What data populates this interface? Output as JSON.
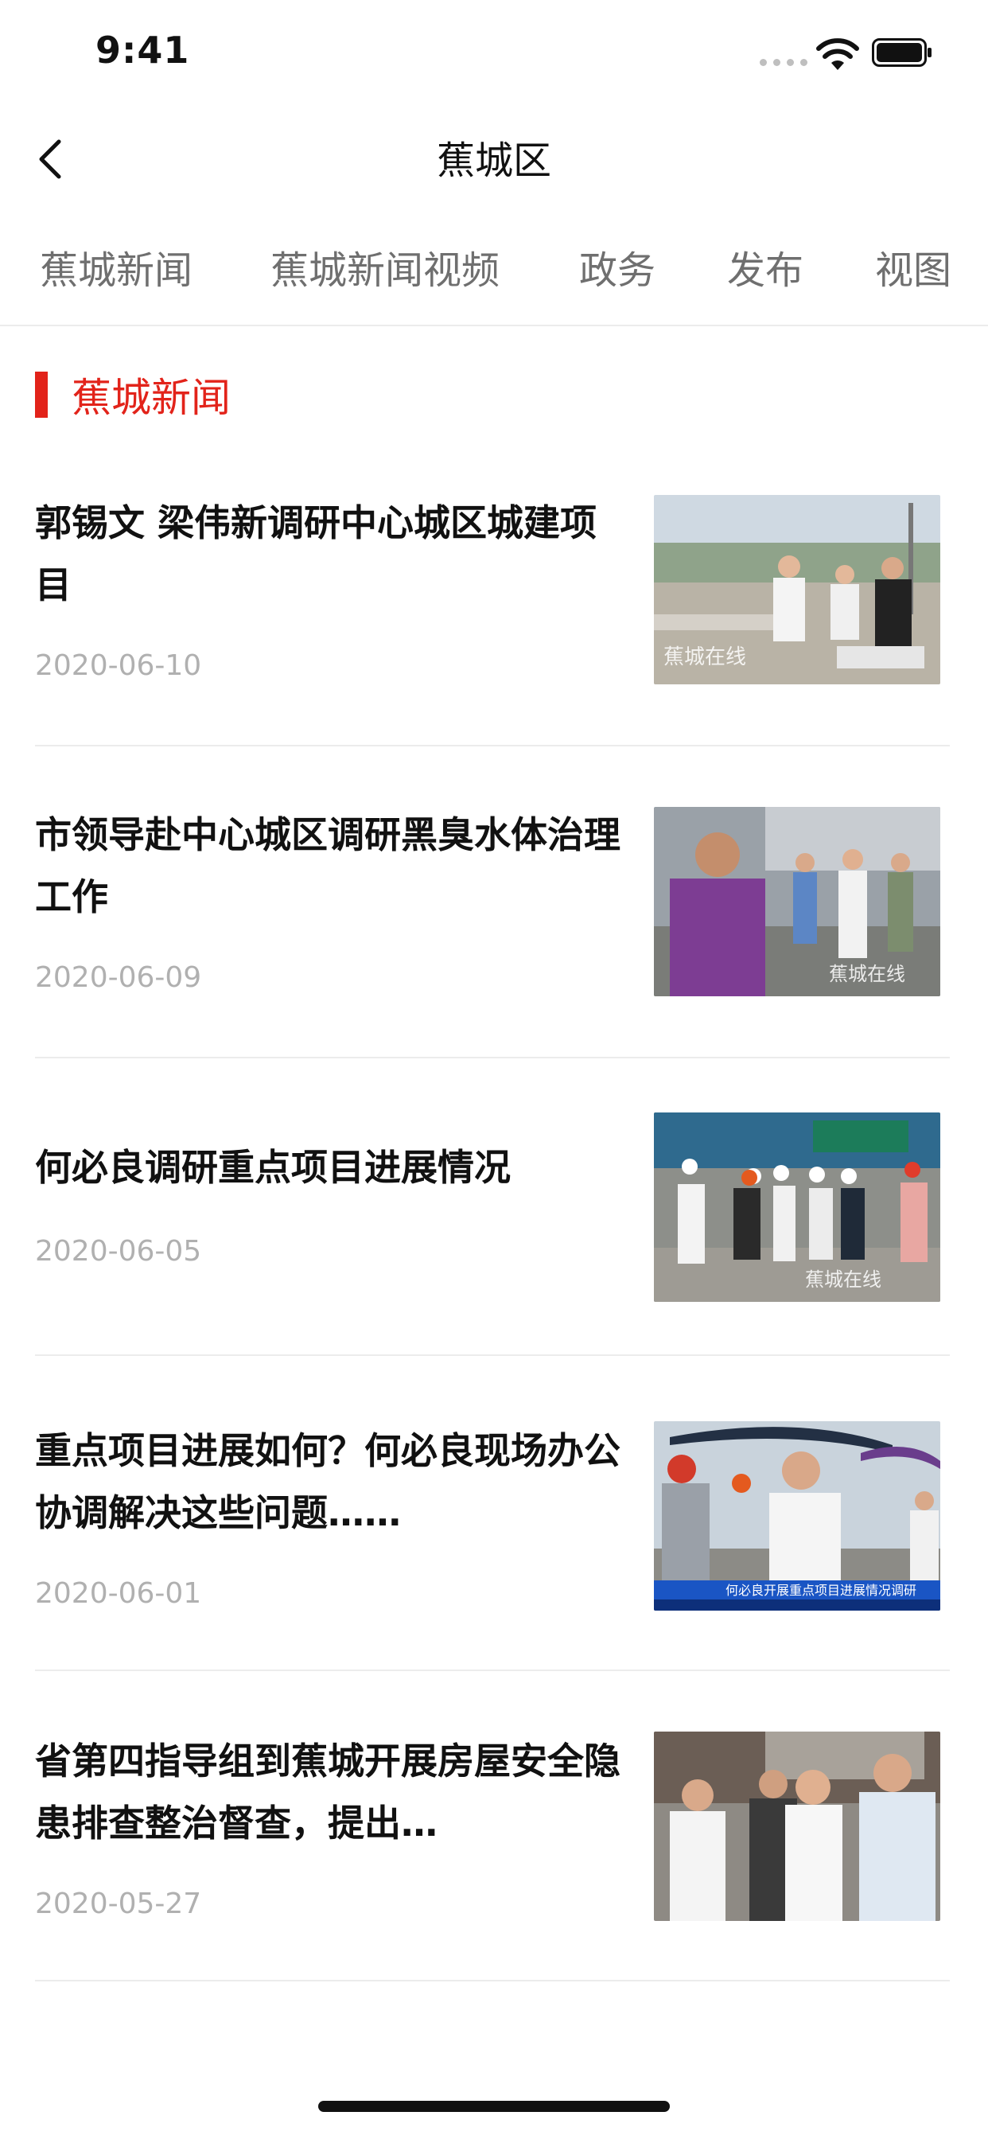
{
  "status": {
    "time": "9:41"
  },
  "nav": {
    "title": "蕉城区",
    "back_icon": "chevron-left-icon"
  },
  "tabs": [
    {
      "label": "蕉城新闻"
    },
    {
      "label": "蕉城新闻视频"
    },
    {
      "label": "政务"
    },
    {
      "label": "发布"
    },
    {
      "label": "视图"
    }
  ],
  "section": {
    "title": "蕉城新闻",
    "accent": "#e2231a"
  },
  "news": [
    {
      "title": "郭锡文 梁伟新调研中心城区城建项目",
      "date": "2020-06-10",
      "watermark": "蕉城在线"
    },
    {
      "title": "市领导赴中心城区调研黑臭水体治理工作",
      "date": "2020-06-09",
      "watermark": "蕉城在线"
    },
    {
      "title": "何必良调研重点项目进展情况",
      "date": "2020-06-05",
      "watermark": "蕉城在线"
    },
    {
      "title": "重点项目进展如何？何必良现场办公协调解决这些问题……",
      "date": "2020-06-01",
      "caption": "何必良开展重点项目进展情况调研"
    },
    {
      "title": "省第四指导组到蕉城开展房屋安全隐患排查整治督查，提出…",
      "date": "2020-05-27",
      "watermark": ""
    }
  ]
}
